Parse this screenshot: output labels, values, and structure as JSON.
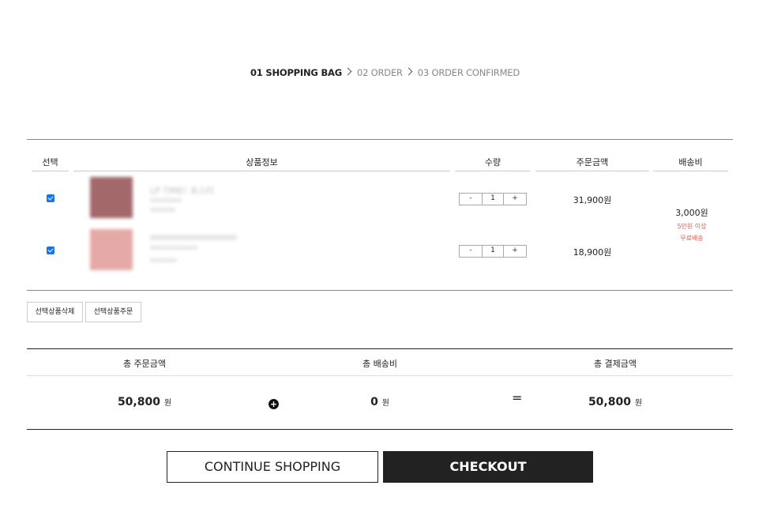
{
  "steps": {
    "step1": "01 SHOPPING BAG",
    "step2": "02 ORDER",
    "step3": "03 ORDER CONFIRMED"
  },
  "cart": {
    "headers": {
      "select": "선택",
      "product": "상품정보",
      "quantity": "수량",
      "order_amount": "주문금액",
      "shipping": "배송비"
    },
    "items": [
      {
        "name": "LP TIME! 포스터",
        "quantity": "1",
        "price": "31,900원",
        "checked": true,
        "thumb_color": "#a2686a"
      },
      {
        "name": "",
        "quantity": "1",
        "price": "18,900원",
        "checked": true,
        "thumb_color": "#e4a9a6"
      }
    ],
    "shipping": {
      "amount": "3,000원",
      "note_line1": "5만원 이상",
      "note_line2": "무료배송"
    },
    "stepper": {
      "minus": "-",
      "plus": "+"
    }
  },
  "actions": {
    "delete_selected": "선택상품삭제",
    "order_selected": "선택상품주문"
  },
  "totals": {
    "order_total_label": "총 주문금액",
    "shipping_total_label": "총 배송비",
    "payment_total_label": "총 결제금액",
    "order_total_value": "50,800",
    "shipping_total_value": "0",
    "payment_total_value": "50,800",
    "currency": "원",
    "plus_symbol": "+",
    "equals_symbol": "="
  },
  "buttons": {
    "continue": "CONTINUE SHOPPING",
    "checkout": "CHECKOUT"
  },
  "colors": {
    "accent_checkbox": "#1a73e8",
    "note_red": "#e05a4e",
    "checkout_bg": "#222222"
  }
}
